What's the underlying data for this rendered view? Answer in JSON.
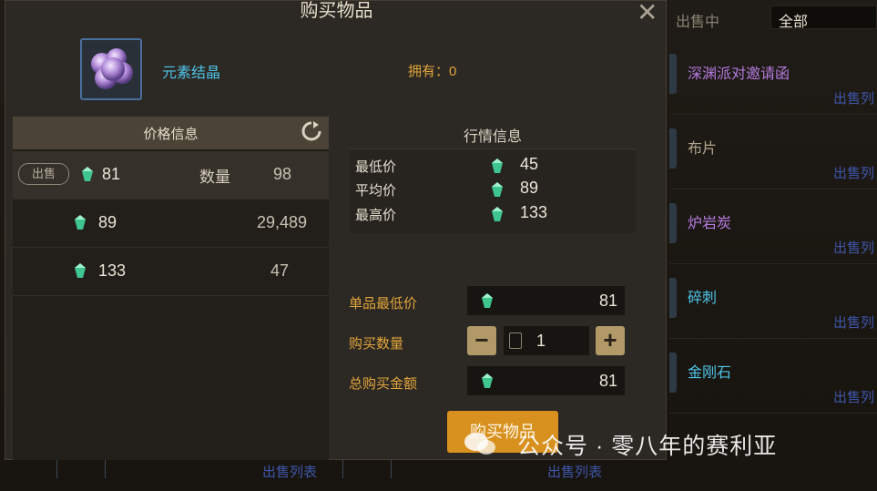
{
  "modal": {
    "title": "购买物品",
    "item_name": "元素结晶",
    "owned_label": "拥有：",
    "owned_count": "0",
    "close_glyph": "✕"
  },
  "price_panel": {
    "header": "价格信息",
    "sell_tag": "出售",
    "quantity_label": "数量",
    "rows": [
      {
        "price": "81",
        "quantity": "98",
        "selected": true
      },
      {
        "price": "89",
        "quantity": "29,489",
        "selected": false
      },
      {
        "price": "133",
        "quantity": "47",
        "selected": false
      }
    ]
  },
  "market_panel": {
    "header": "行情信息",
    "lowest_label": "最低价",
    "lowest": "45",
    "average_label": "平均价",
    "average": "89",
    "highest_label": "最高价",
    "highest": "133"
  },
  "form": {
    "unit_price_label": "单品最低价",
    "unit_price": "81",
    "quantity_label": "购买数量",
    "quantity": "1",
    "total_label": "总购买金额",
    "total": "81",
    "minus": "−",
    "plus": "+"
  },
  "buy_button": "购买物品",
  "background_list": {
    "tab": "出售中",
    "filter": "全部",
    "items": [
      {
        "name": "深渊派对邀请函",
        "status": "出售列",
        "color": "#b57be0"
      },
      {
        "name": "布片",
        "status": "出售列",
        "color": "#b0a48e"
      },
      {
        "name": "炉岩炭",
        "status": "出售列",
        "color": "#b57be0"
      },
      {
        "name": "碎刺",
        "status": "出售列",
        "color": "#4fc4e8"
      },
      {
        "name": "金刚石",
        "status": "出售列",
        "color": "#4fc4e8"
      }
    ],
    "bottom_status": [
      "出售列表",
      "出售列表"
    ]
  },
  "watermark": "公众号 · 零八年的赛利亚",
  "icons": {
    "gem": "green-gem-icon",
    "refresh": "refresh-icon",
    "calculator": "calculator-icon",
    "close": "close-icon"
  },
  "colors": {
    "accent_orange": "#d8901e",
    "gold_label": "#e2a63c",
    "item_blue": "#4fc4e8",
    "status_blue": "#3f56a8"
  }
}
